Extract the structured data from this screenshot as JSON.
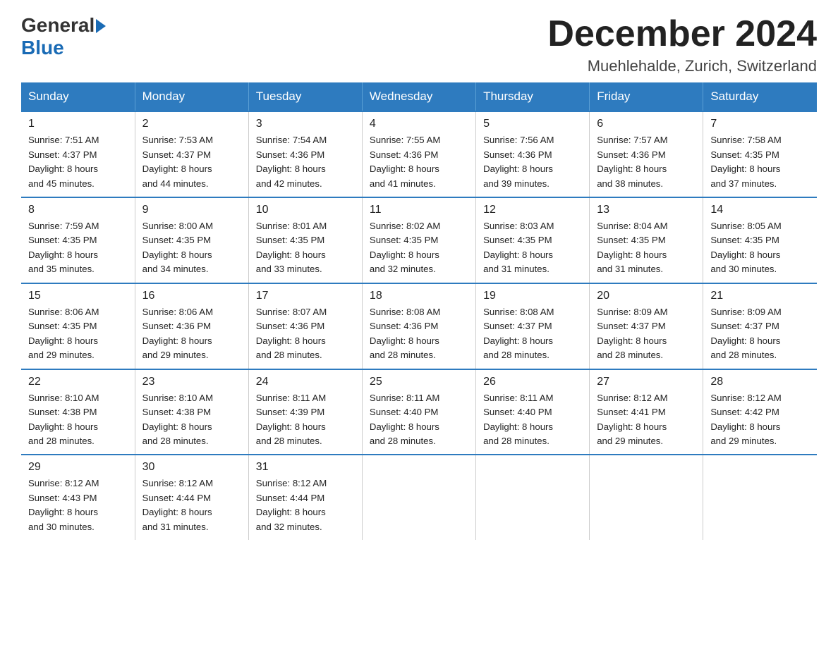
{
  "logo": {
    "general": "General",
    "blue": "Blue"
  },
  "title": "December 2024",
  "location": "Muehlehalde, Zurich, Switzerland",
  "days_of_week": [
    "Sunday",
    "Monday",
    "Tuesday",
    "Wednesday",
    "Thursday",
    "Friday",
    "Saturday"
  ],
  "weeks": [
    [
      {
        "day": "1",
        "sunrise": "7:51 AM",
        "sunset": "4:37 PM",
        "daylight": "8 hours and 45 minutes."
      },
      {
        "day": "2",
        "sunrise": "7:53 AM",
        "sunset": "4:37 PM",
        "daylight": "8 hours and 44 minutes."
      },
      {
        "day": "3",
        "sunrise": "7:54 AM",
        "sunset": "4:36 PM",
        "daylight": "8 hours and 42 minutes."
      },
      {
        "day": "4",
        "sunrise": "7:55 AM",
        "sunset": "4:36 PM",
        "daylight": "8 hours and 41 minutes."
      },
      {
        "day": "5",
        "sunrise": "7:56 AM",
        "sunset": "4:36 PM",
        "daylight": "8 hours and 39 minutes."
      },
      {
        "day": "6",
        "sunrise": "7:57 AM",
        "sunset": "4:36 PM",
        "daylight": "8 hours and 38 minutes."
      },
      {
        "day": "7",
        "sunrise": "7:58 AM",
        "sunset": "4:35 PM",
        "daylight": "8 hours and 37 minutes."
      }
    ],
    [
      {
        "day": "8",
        "sunrise": "7:59 AM",
        "sunset": "4:35 PM",
        "daylight": "8 hours and 35 minutes."
      },
      {
        "day": "9",
        "sunrise": "8:00 AM",
        "sunset": "4:35 PM",
        "daylight": "8 hours and 34 minutes."
      },
      {
        "day": "10",
        "sunrise": "8:01 AM",
        "sunset": "4:35 PM",
        "daylight": "8 hours and 33 minutes."
      },
      {
        "day": "11",
        "sunrise": "8:02 AM",
        "sunset": "4:35 PM",
        "daylight": "8 hours and 32 minutes."
      },
      {
        "day": "12",
        "sunrise": "8:03 AM",
        "sunset": "4:35 PM",
        "daylight": "8 hours and 31 minutes."
      },
      {
        "day": "13",
        "sunrise": "8:04 AM",
        "sunset": "4:35 PM",
        "daylight": "8 hours and 31 minutes."
      },
      {
        "day": "14",
        "sunrise": "8:05 AM",
        "sunset": "4:35 PM",
        "daylight": "8 hours and 30 minutes."
      }
    ],
    [
      {
        "day": "15",
        "sunrise": "8:06 AM",
        "sunset": "4:35 PM",
        "daylight": "8 hours and 29 minutes."
      },
      {
        "day": "16",
        "sunrise": "8:06 AM",
        "sunset": "4:36 PM",
        "daylight": "8 hours and 29 minutes."
      },
      {
        "day": "17",
        "sunrise": "8:07 AM",
        "sunset": "4:36 PM",
        "daylight": "8 hours and 28 minutes."
      },
      {
        "day": "18",
        "sunrise": "8:08 AM",
        "sunset": "4:36 PM",
        "daylight": "8 hours and 28 minutes."
      },
      {
        "day": "19",
        "sunrise": "8:08 AM",
        "sunset": "4:37 PM",
        "daylight": "8 hours and 28 minutes."
      },
      {
        "day": "20",
        "sunrise": "8:09 AM",
        "sunset": "4:37 PM",
        "daylight": "8 hours and 28 minutes."
      },
      {
        "day": "21",
        "sunrise": "8:09 AM",
        "sunset": "4:37 PM",
        "daylight": "8 hours and 28 minutes."
      }
    ],
    [
      {
        "day": "22",
        "sunrise": "8:10 AM",
        "sunset": "4:38 PM",
        "daylight": "8 hours and 28 minutes."
      },
      {
        "day": "23",
        "sunrise": "8:10 AM",
        "sunset": "4:38 PM",
        "daylight": "8 hours and 28 minutes."
      },
      {
        "day": "24",
        "sunrise": "8:11 AM",
        "sunset": "4:39 PM",
        "daylight": "8 hours and 28 minutes."
      },
      {
        "day": "25",
        "sunrise": "8:11 AM",
        "sunset": "4:40 PM",
        "daylight": "8 hours and 28 minutes."
      },
      {
        "day": "26",
        "sunrise": "8:11 AM",
        "sunset": "4:40 PM",
        "daylight": "8 hours and 28 minutes."
      },
      {
        "day": "27",
        "sunrise": "8:12 AM",
        "sunset": "4:41 PM",
        "daylight": "8 hours and 29 minutes."
      },
      {
        "day": "28",
        "sunrise": "8:12 AM",
        "sunset": "4:42 PM",
        "daylight": "8 hours and 29 minutes."
      }
    ],
    [
      {
        "day": "29",
        "sunrise": "8:12 AM",
        "sunset": "4:43 PM",
        "daylight": "8 hours and 30 minutes."
      },
      {
        "day": "30",
        "sunrise": "8:12 AM",
        "sunset": "4:44 PM",
        "daylight": "8 hours and 31 minutes."
      },
      {
        "day": "31",
        "sunrise": "8:12 AM",
        "sunset": "4:44 PM",
        "daylight": "8 hours and 32 minutes."
      },
      null,
      null,
      null,
      null
    ]
  ],
  "labels": {
    "sunrise": "Sunrise:",
    "sunset": "Sunset:",
    "daylight": "Daylight:"
  }
}
